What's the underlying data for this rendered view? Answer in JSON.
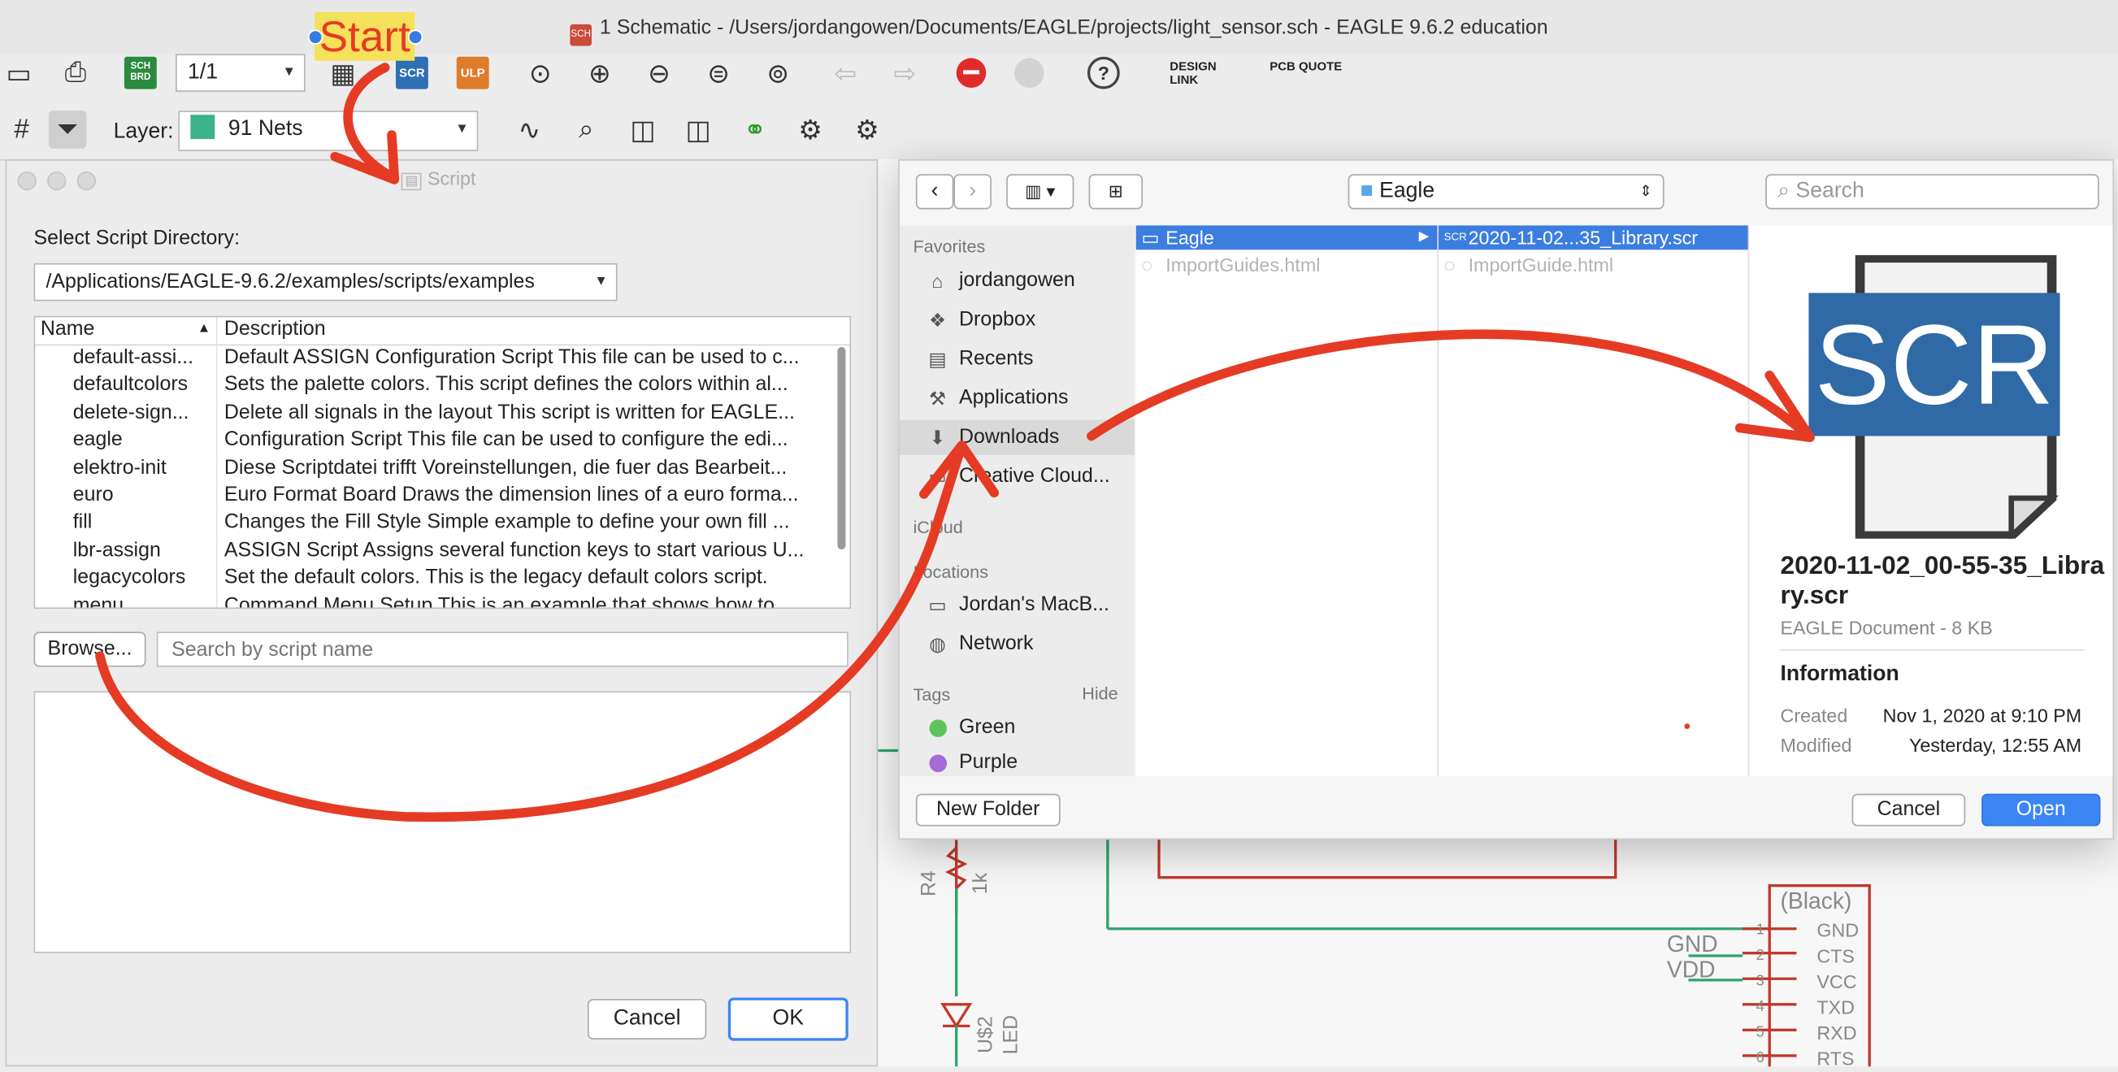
{
  "window_title": "1 Schematic - /Users/jordangowen/Documents/EAGLE/projects/light_sensor.sch - EAGLE 9.6.2 education",
  "toolbar": {
    "sheet_combo": "1/1",
    "sch_brd_label": "SCH BRD",
    "scr_label": "SCR",
    "ulp_label": "ULP",
    "design_link": "DESIGN LINK",
    "pcb_quote": "PCB QUOTE",
    "help": "?",
    "layer_label": "Layer:",
    "layer_value": "91 Nets",
    "layer_color": "#3cb38a"
  },
  "annotation": {
    "start_label": "Start",
    "arrow_color": "#e53b24"
  },
  "script_dialog": {
    "title": "Script",
    "dir_label": "Select Script Directory:",
    "dir_value": "/Applications/EAGLE-9.6.2/examples/scripts/examples",
    "col_name": "Name",
    "col_desc": "Description",
    "rows": [
      {
        "name": "default-assi...",
        "desc": "Default ASSIGN Configuration Script This file can be used to c..."
      },
      {
        "name": "defaultcolors",
        "desc": "Sets the palette colors. This script defines the colors within al..."
      },
      {
        "name": "delete-sign...",
        "desc": "Delete all signals in the layout This script is written for EAGLE..."
      },
      {
        "name": "eagle",
        "desc": "Configuration Script This file can be used to configure the edi..."
      },
      {
        "name": "elektro-init",
        "desc": "Diese Scriptdatei trifft Voreinstellungen, die fuer das  Bearbeit..."
      },
      {
        "name": "euro",
        "desc": "Euro Format Board Draws the dimension lines of a euro forma..."
      },
      {
        "name": "fill",
        "desc": "Changes the Fill Style Simple example to define your own fill ..."
      },
      {
        "name": "lbr-assign",
        "desc": "ASSIGN Script Assigns several function keys to start various U..."
      },
      {
        "name": "legacycolors",
        "desc": "Set the default colors. This is the legacy default colors script."
      },
      {
        "name": "menu",
        "desc": "Command Menu Setup This is an example that shows how to..."
      }
    ],
    "browse": "Browse...",
    "search_placeholder": "Search by script name",
    "cancel": "Cancel",
    "ok": "OK"
  },
  "file_dialog": {
    "location": "Eagle",
    "search_placeholder": "Search",
    "favorites_label": "Favorites",
    "favorites": [
      "jordangowen",
      "Dropbox",
      "Recents",
      "Applications",
      "Downloads",
      "Creative Cloud..."
    ],
    "icloud_label": "iCloud",
    "locations_label": "Locations",
    "locations": [
      "Jordan's MacB...",
      "Network"
    ],
    "tags_label": "Tags",
    "hide": "Hide",
    "tags": [
      {
        "name": "Green",
        "color": "#5cc45c"
      },
      {
        "name": "Purple",
        "color": "#a56ad6"
      }
    ],
    "col1": [
      {
        "name": "Eagle",
        "selected": true
      },
      {
        "name": "ImportGuides.html",
        "selected": false
      }
    ],
    "col2": [
      {
        "name": "2020-11-02...35_Library.scr",
        "selected": true
      },
      {
        "name": "ImportGuide.html",
        "selected": false
      }
    ],
    "preview": {
      "icon_text": "SCR",
      "filename": "2020-11-02_00-55-35_Library.scr",
      "kind": "EAGLE Document - 8 KB",
      "info_heading": "Information",
      "created_label": "Created",
      "created_value": "Nov 1, 2020 at 9:10 PM",
      "modified_label": "Modified",
      "modified_value": "Yesterday, 12:55 AM"
    },
    "new_folder": "New Folder",
    "cancel": "Cancel",
    "open": "Open"
  },
  "schematic": {
    "part_name": "(Black)",
    "pins": [
      "GND",
      "CTS",
      "VCC",
      "TXD",
      "RXD",
      "RTS"
    ],
    "pin_numbers": [
      "1",
      "2",
      "3",
      "4",
      "5",
      "6"
    ],
    "net_labels": [
      "GND",
      "VDD"
    ],
    "r4": "R4",
    "r4_value": "1k",
    "led_ref": "U$2",
    "led_label": "LED"
  }
}
